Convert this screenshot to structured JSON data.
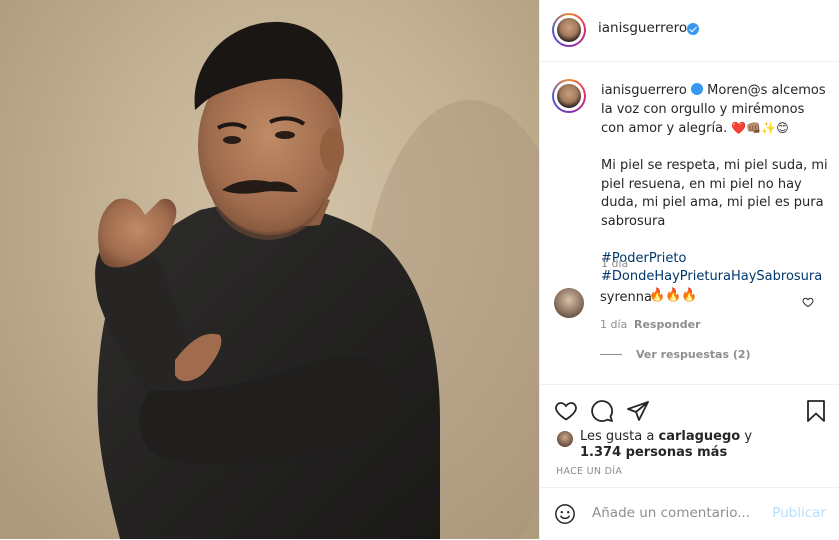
{
  "header": {
    "username": "ianisguerrero"
  },
  "caption": {
    "username": "ianisguerrero",
    "line1": "Moren@s alcemos la voz con orgullo y mirémonos con amor y alegría.",
    "emojis": "❤️👊🏽✨😊",
    "para2": "Mi piel se respeta, mi piel suda, mi piel resuena, en mi piel no hay duda, mi piel ama, mi piel es pura sabrosura",
    "hashtags": [
      "#PoderPrieto",
      "#DondeHayPrieturaHaySabrosura"
    ],
    "age": "1 día"
  },
  "comment": {
    "username": "syrenna",
    "text": "🔥🔥🔥",
    "age": "1 día",
    "reply_label": "Responder",
    "view_replies": "Ver respuestas (2)"
  },
  "likes": {
    "prefix": "Les gusta a ",
    "user": "carlaguego",
    "suffix": " y",
    "others": "1.374 personas más"
  },
  "timestamp": "HACE UN DÍA",
  "add_comment": {
    "placeholder": "Añade un comentario...",
    "publish": "Publicar"
  },
  "colors": {
    "link": "#00376b",
    "verified": "#3897f0",
    "muted": "#8e8e8e",
    "publish_disabled": "#b2dffc"
  },
  "icons": [
    "verified-icon",
    "heart-icon",
    "comment-icon",
    "share-icon",
    "bookmark-icon",
    "emoji-icon",
    "like-comment-icon"
  ]
}
